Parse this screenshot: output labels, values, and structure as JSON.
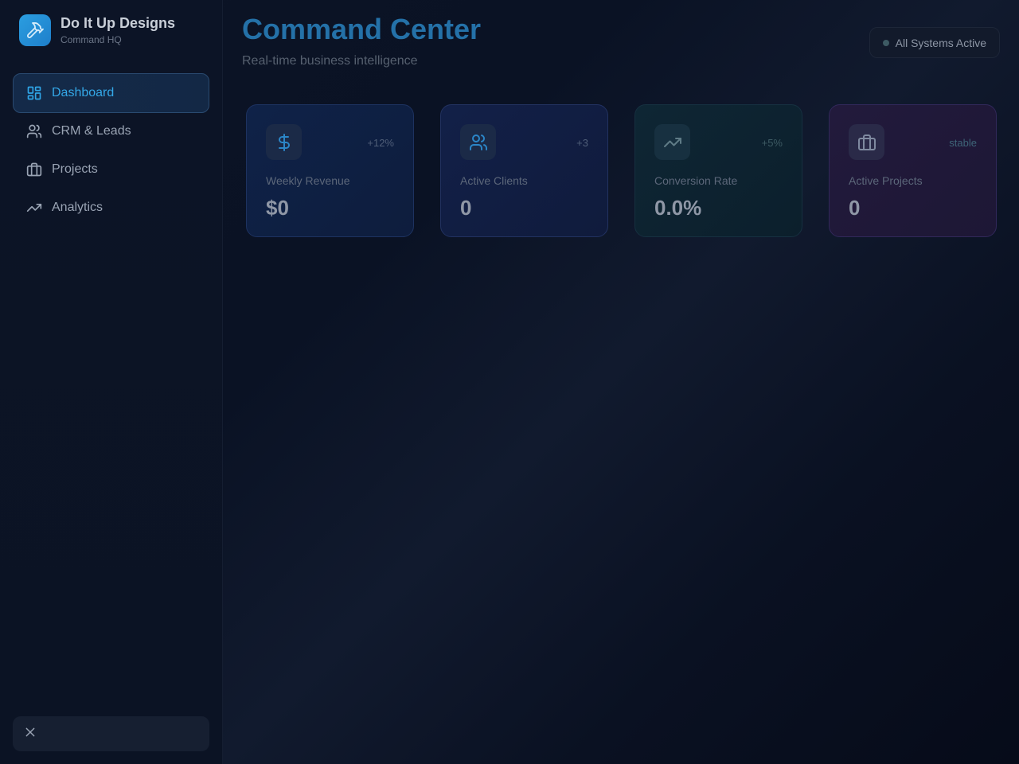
{
  "brand": {
    "name": "Do It Up Designs",
    "subtitle": "Command HQ",
    "logo_icon": "hammer-icon",
    "accent": "#2b9ee0"
  },
  "sidebar": {
    "items": [
      {
        "label": "Dashboard",
        "icon": "dashboard-icon",
        "active": true
      },
      {
        "label": "CRM & Leads",
        "icon": "users-icon",
        "active": false
      },
      {
        "label": "Projects",
        "icon": "briefcase-icon",
        "active": false
      },
      {
        "label": "Analytics",
        "icon": "trending-up-icon",
        "active": false
      }
    ],
    "footer_icon": "close-icon"
  },
  "header": {
    "title": "Command Center",
    "subtitle": "Real-time business intelligence",
    "status": "All Systems Active",
    "title_color": "#2471a8"
  },
  "stats": [
    {
      "label": "Weekly Revenue",
      "value": "$0",
      "change": "+12%",
      "icon": "dollar-icon"
    },
    {
      "label": "Active Clients",
      "value": "0",
      "change": "+3",
      "icon": "users-icon"
    },
    {
      "label": "Conversion Rate",
      "value": "0.0%",
      "change": "+5%",
      "icon": "trending-up-icon"
    },
    {
      "label": "Active Projects",
      "value": "0",
      "change": "stable",
      "icon": "briefcase-icon"
    }
  ]
}
